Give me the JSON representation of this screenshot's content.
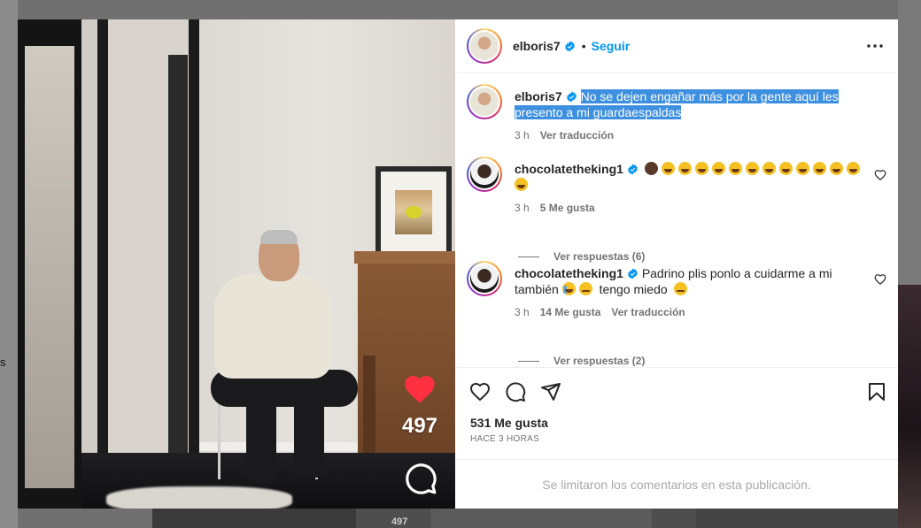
{
  "background": {
    "left_edge_text": "s",
    "bottom_tile_label": "497"
  },
  "colors": {
    "accent": "#0095f6",
    "highlight": "#3d8fe0",
    "like_red": "#ff3040",
    "muted": "#737373"
  },
  "reel": {
    "like_count": "497",
    "like_icon": "heart-icon",
    "comment_icon": "speech-bubble-icon"
  },
  "post": {
    "author": {
      "username": "elboris7",
      "verified_icon": "verified-badge-icon"
    },
    "follow_label": "Seguir",
    "separator": "•",
    "more_icon": "more-options-icon",
    "caption": {
      "username": "elboris7",
      "text": "No se dejen engañar más por la gente aquí les presento a mi guardaespaldas",
      "time": "3 h",
      "translate_label": "Ver traducción"
    },
    "comments": [
      {
        "username": "chocolatetheking1",
        "emoji_summary": "👨🏿😂😂😂😂😂😂😂😂😂😂😂😂😂",
        "time": "3 h",
        "likes": "5 Me gusta",
        "replies_label": "Ver respuestas (6)"
      },
      {
        "username": "chocolatetheking1",
        "text_a": "Padrino plis ponlo a cuidarme a mi también",
        "text_b": "tengo miedo",
        "time": "3 h",
        "likes": "14 Me gusta",
        "translate_label": "Ver traducción",
        "replies_label": "Ver respuestas (2)"
      }
    ],
    "likes_label": "531 Me gusta",
    "timestamp": "HACE 3 HORAS",
    "comments_limited": "Se limitaron los comentarios en esta publicación."
  }
}
